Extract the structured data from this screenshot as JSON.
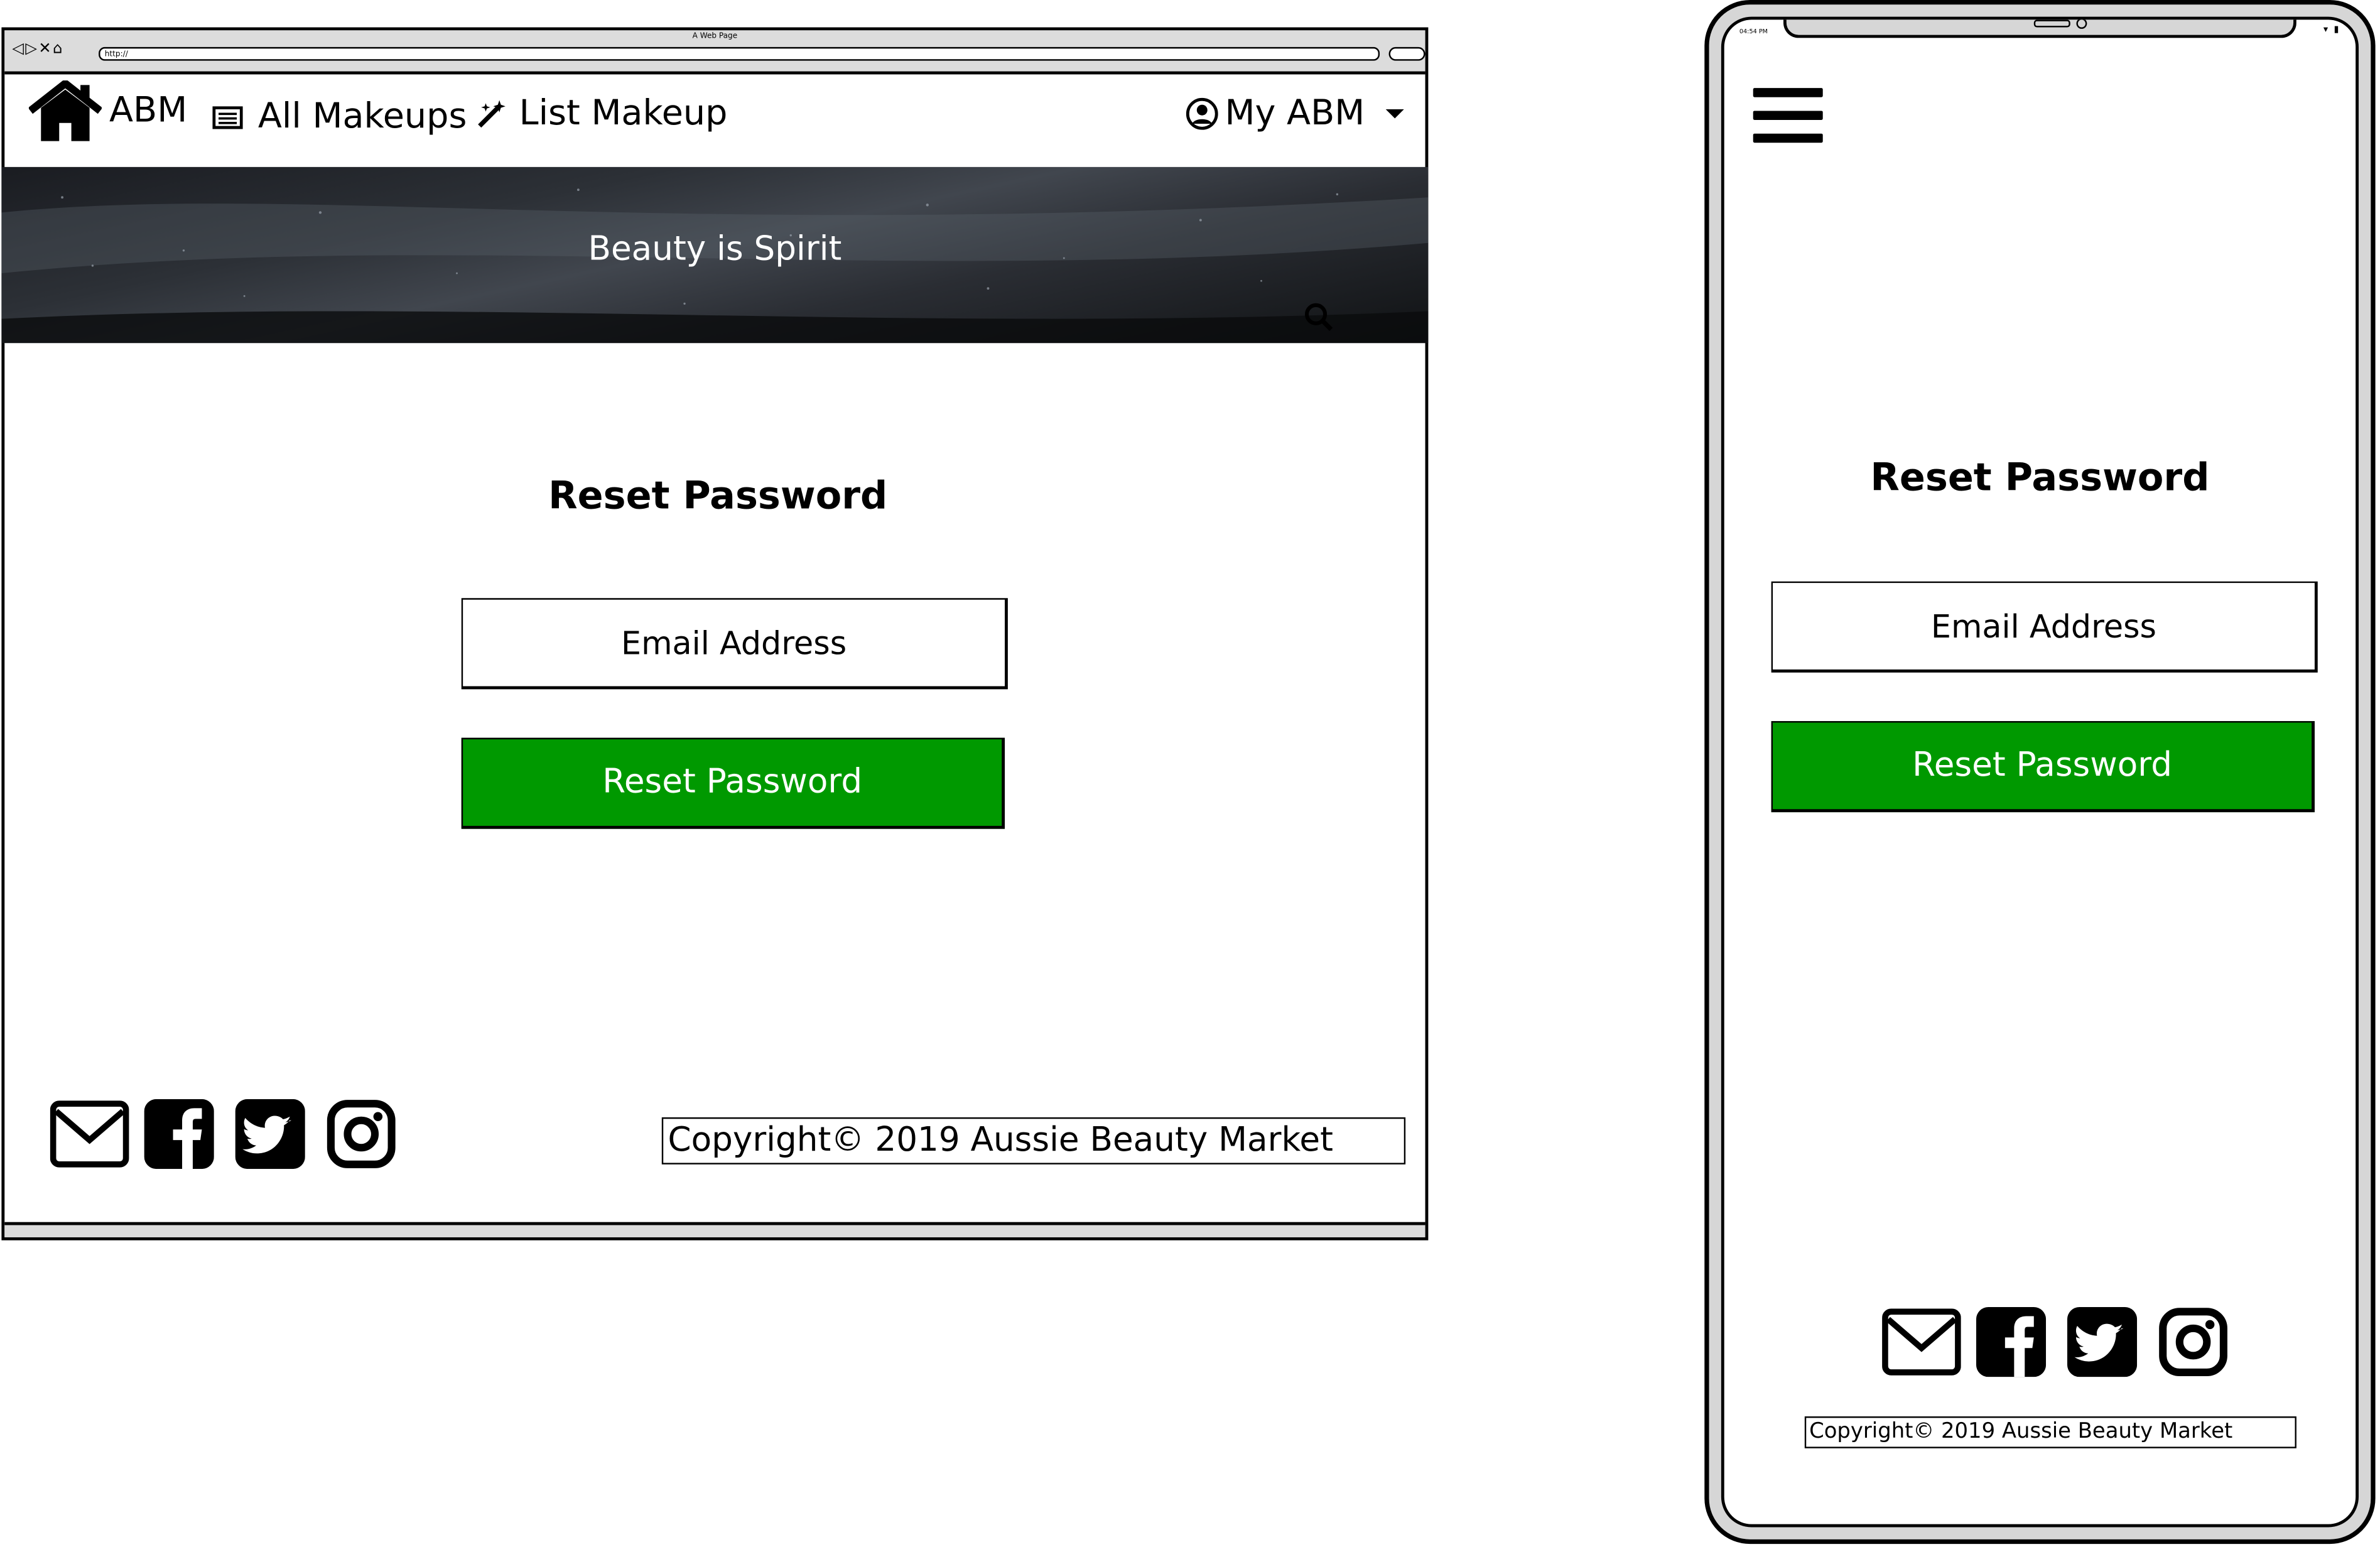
{
  "desktop": {
    "window_title": "A Web Page",
    "url": "http://",
    "nav": {
      "brand": "ABM",
      "all_makeups": "All Makeups",
      "list_makeup": "List Makeup",
      "account": "My ABM"
    },
    "hero": {
      "tagline": "Beauty is Spirit"
    },
    "form": {
      "heading": "Reset Password",
      "email_label": "Email Address",
      "submit_label": "Reset Password"
    },
    "footer": {
      "icons": [
        "envelope-icon",
        "facebook-icon",
        "twitter-icon",
        "instagram-icon"
      ],
      "copyright": "Copyright© 2019 Aussie Beauty Market"
    }
  },
  "mobile": {
    "status_time": "04:54 PM",
    "form": {
      "heading": "Reset Password",
      "email_label": "Email Address",
      "submit_label": "Reset Password"
    },
    "footer": {
      "icons": [
        "envelope-icon",
        "facebook-icon",
        "twitter-icon",
        "instagram-icon"
      ],
      "copyright": "Copyright© 2019 Aussie Beauty Market"
    }
  },
  "colors": {
    "accent_green": "#009900",
    "hero_dark": "#2c3036",
    "frame_gray": "#dcdcdc"
  }
}
